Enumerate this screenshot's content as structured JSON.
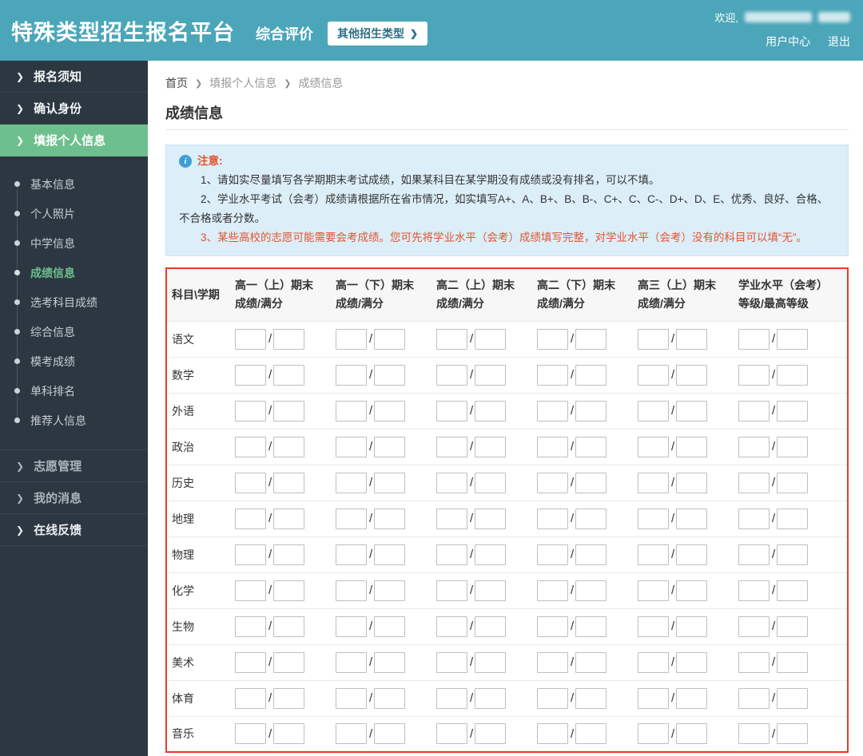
{
  "header": {
    "title": "特殊类型招生报名平台",
    "subtitle": "综合评价",
    "other_types_button": "其他招生类型",
    "welcome_label": "欢迎,",
    "user_center": "用户中心",
    "logout": "退出"
  },
  "colors": {
    "header_bg": "#4BA6B9",
    "sidebar_bg": "#2D3741",
    "active_green": "#6DC08D",
    "notice_bg": "#DCEEF8",
    "notice_warn_text": "#E25430",
    "table_border": "#EA3B23"
  },
  "sidebar": {
    "top_items": [
      {
        "label": "报名须知",
        "active": false
      },
      {
        "label": "确认身份",
        "active": false
      },
      {
        "label": "填报个人信息",
        "active": true
      }
    ],
    "sub_items": [
      {
        "label": "基本信息",
        "active": false
      },
      {
        "label": "个人照片",
        "active": false
      },
      {
        "label": "中学信息",
        "active": false
      },
      {
        "label": "成绩信息",
        "active": true
      },
      {
        "label": "选考科目成绩",
        "active": false
      },
      {
        "label": "综合信息",
        "active": false
      },
      {
        "label": "模考成绩",
        "active": false
      },
      {
        "label": "单科排名",
        "active": false
      },
      {
        "label": "推荐人信息",
        "active": false
      }
    ],
    "bottom_items": [
      {
        "label": "志愿管理"
      },
      {
        "label": "我的消息"
      },
      {
        "label": "在线反馈"
      }
    ]
  },
  "breadcrumb": {
    "items": [
      "首页",
      "填报个人信息",
      "成绩信息"
    ]
  },
  "page": {
    "title": "成绩信息"
  },
  "notice": {
    "title": "注意:",
    "lines": [
      {
        "text": "1、请如实尽量填写各学期期末考试成绩，如果某科目在某学期没有成绩或没有排名，可以不填。",
        "warn": false
      },
      {
        "text": "2、学业水平考试（会考）成绩请根据所在省市情况，如实填写A+、A、B+、B、B-、C+、C、C-、D+、D、E、优秀、良好、合格、不合格或者分数。",
        "warn": false
      },
      {
        "text": "3、某些高校的志愿可能需要会考成绩。您可先将学业水平（会考）成绩填写完整，对学业水平（会考）没有的科目可以填“无”。",
        "warn": true
      }
    ]
  },
  "table": {
    "corner_header": "科目\\学期",
    "columns": [
      {
        "line1": "高一（上）期末",
        "line2": "成绩/满分"
      },
      {
        "line1": "高一（下）期末",
        "line2": "成绩/满分"
      },
      {
        "line1": "高二（上）期末",
        "line2": "成绩/满分"
      },
      {
        "line1": "高二（下）期末",
        "line2": "成绩/满分"
      },
      {
        "line1": "高三（上）期末",
        "line2": "成绩/满分"
      },
      {
        "line1": "学业水平（会考）",
        "line2": "等级/最高等级"
      }
    ],
    "subjects": [
      "语文",
      "数学",
      "外语",
      "政治",
      "历史",
      "地理",
      "物理",
      "化学",
      "生物",
      "美术",
      "体育",
      "音乐"
    ],
    "separator": "/",
    "input_value": ""
  }
}
